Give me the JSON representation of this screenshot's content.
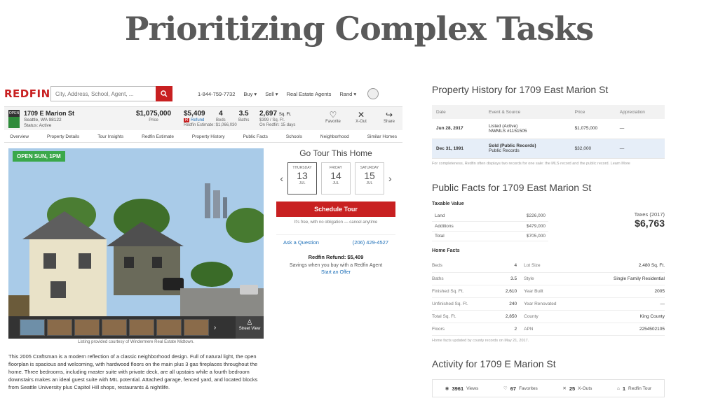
{
  "slide_title": "Prioritizing Complex Tasks",
  "nav": {
    "logo": "REDFIN",
    "search_placeholder": "City, Address, School, Agent, ...",
    "phone": "1-844-759-7732",
    "buy": "Buy",
    "sell": "Sell",
    "agents": "Real Estate Agents",
    "user": "Rand"
  },
  "header": {
    "badge": "OPEN",
    "street": "1709 E Marion St",
    "city": "Seattle, WA 98122",
    "status": "Status: Active",
    "price": "$1,075,000",
    "price_label": "Price",
    "estimate_value": "$5,409",
    "estimate_label": "Refund",
    "estimate_sub": "Redfin Estimate: $1,066,030",
    "beds": "4",
    "beds_label": "Beds",
    "baths": "3.5",
    "baths_label": "Baths",
    "sqft": "2,697",
    "sqft_unit": "Sq. Ft.",
    "sqft_sub": "$399 / Sq. Ft.",
    "on_redfin": "On Redfin: 15 days",
    "favorite": "Favorite",
    "xout": "X-Out",
    "share": "Share"
  },
  "tabs": [
    "Overview",
    "Property Details",
    "Tour Insights",
    "Redfin Estimate",
    "Property History",
    "Public Facts",
    "Schools",
    "Neighborhood",
    "Similar Homes"
  ],
  "photo": {
    "badge": "OPEN SUN, 1PM",
    "street_view": "Street View",
    "credit": "Listing provided courtesy of Windermere Real Estate Midtown."
  },
  "description": "This 2005 Craftsman is a modern reflection of a classic neighborhood design. Full of natural light, the open floorplan is spacious and welcoming, with hardwood floors on the main plus 3 gas fireplaces throughout the home. Three bedrooms, including master suite with private deck, are all upstairs while a fourth bedroom downstairs makes an ideal guest suite with MIL potential. Attached garage, fenced yard, and located blocks from Seattle University plus Capitol Hill shops, restaurants & nightlife.",
  "tour": {
    "title": "Go Tour This Home",
    "days": [
      {
        "weekday": "THURSDAY",
        "day": "13",
        "month": "JUL"
      },
      {
        "weekday": "FRIDAY",
        "day": "14",
        "month": "JUL"
      },
      {
        "weekday": "SATURDAY",
        "day": "15",
        "month": "JUL"
      }
    ],
    "schedule": "Schedule Tour",
    "free": "It's free, with no obligation — cancel anytime",
    "ask": "Ask a Question",
    "phone": "(206) 429-4527",
    "refund": "Redfin Refund: $5,409",
    "refund_sub": "Savings when you buy with a Redfin Agent",
    "start_offer": "Start an Offer"
  },
  "property_history": {
    "title": "Property History for 1709 East Marion St",
    "headers": [
      "Date",
      "Event & Source",
      "Price",
      "Appreciation"
    ],
    "rows": [
      {
        "date": "Jun 28, 2017",
        "event": "Listed (Active)",
        "source": "NWMLS #1151505",
        "price": "$1,075,000",
        "appreciation": "—"
      },
      {
        "date": "Dec 31, 1991",
        "event": "Sold (Public Records)",
        "source": "Public Records",
        "price": "$32,000",
        "appreciation": "—"
      }
    ],
    "note": "For completeness, Redfin often displays two records for one sale: the MLS record and the public record. Learn More"
  },
  "public_facts": {
    "title": "Public Facts for 1709 East Marion St",
    "taxable_label": "Taxable Value",
    "taxable": [
      {
        "label": "Land",
        "value": "$226,000"
      },
      {
        "label": "Additions",
        "value": "$479,000"
      },
      {
        "label": "Total",
        "value": "$705,000"
      }
    ],
    "taxes_label": "Taxes (2017)",
    "taxes_value": "$6,763",
    "home_facts_label": "Home Facts",
    "facts": [
      {
        "l1": "Beds",
        "v1": "4",
        "l2": "Lot Size",
        "v2": "2,480 Sq. Ft."
      },
      {
        "l1": "Baths",
        "v1": "3.5",
        "l2": "Style",
        "v2": "Single Family Residential"
      },
      {
        "l1": "Finished Sq. Ft.",
        "v1": "2,610",
        "l2": "Year Built",
        "v2": "2005"
      },
      {
        "l1": "Unfinished Sq. Ft.",
        "v1": "240",
        "l2": "Year Renovated",
        "v2": "—"
      },
      {
        "l1": "Total Sq. Ft.",
        "v1": "2,850",
        "l2": "County",
        "v2": "King County"
      },
      {
        "l1": "Floors",
        "v1": "2",
        "l2": "APN",
        "v2": "2254502105"
      }
    ],
    "note": "Home facts updated by county records on May 21, 2017."
  },
  "activity": {
    "title": "Activity for 1709 E Marion St",
    "views": "3961",
    "views_label": "Views",
    "favorites": "67",
    "favorites_label": "Favorites",
    "xouts": "25",
    "xouts_label": "X-Outs",
    "tours": "1",
    "tours_label": "Redfin Tour"
  },
  "colors": {
    "brand": "#c82021",
    "link": "#1d6fb8",
    "open_badge": "#3aa84a"
  }
}
